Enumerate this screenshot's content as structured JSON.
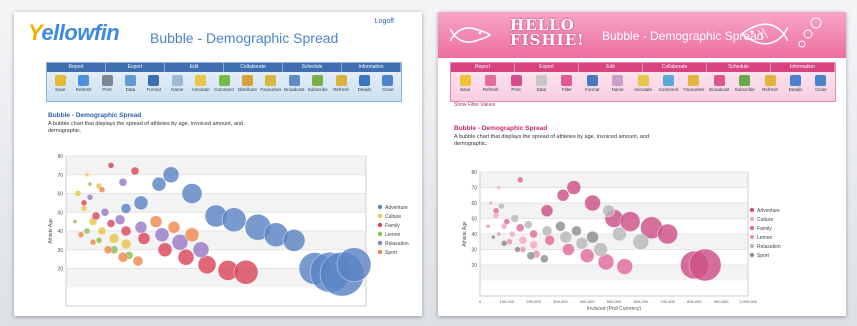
{
  "left": {
    "logo": {
      "first": "Y",
      "rest": "ellowfin"
    },
    "title": "Bubble - Demographic Spread",
    "logoff": "Logoff",
    "toolbar_groups": [
      "Report",
      "Export",
      "Edit",
      "Collaborate",
      "Schedule",
      "Information"
    ],
    "toolbar_buttons": [
      {
        "label": "Save",
        "icon": "save-icon",
        "color": "#e6b93a"
      },
      {
        "label": "Refresh",
        "icon": "refresh-icon",
        "color": "#4c92d8"
      },
      {
        "label": "Print",
        "icon": "print-icon",
        "color": "#7a8794"
      },
      {
        "label": "Data",
        "icon": "data-icon",
        "color": "#5f9ad6"
      },
      {
        "label": "Format",
        "icon": "format-icon",
        "color": "#3d6fae"
      },
      {
        "label": "Name",
        "icon": "name-icon",
        "color": "#9fb8d4"
      },
      {
        "label": "Annotate",
        "icon": "annotate-icon",
        "color": "#e9c648"
      },
      {
        "label": "Comment",
        "icon": "comment-icon",
        "color": "#78b848"
      },
      {
        "label": "Distribute",
        "icon": "distribute-icon",
        "color": "#d7a23a"
      },
      {
        "label": "Favourites",
        "icon": "favourites-icon",
        "color": "#d9b63f"
      },
      {
        "label": "Broadcast",
        "icon": "broadcast-icon",
        "color": "#6189c2"
      },
      {
        "label": "Subscribe",
        "icon": "subscribe-icon",
        "color": "#79b04a"
      },
      {
        "label": "Refresh",
        "icon": "schedule-refresh-icon",
        "color": "#d8b23a"
      },
      {
        "label": "Details",
        "icon": "info-icon",
        "color": "#3d74c4"
      },
      {
        "label": "Close",
        "icon": "close-icon",
        "color": "#4c83cc"
      }
    ],
    "section_title": "Bubble - Demographic Spread",
    "section_desc": "A bubble chart that displays the spread of athletes by age, invoiced amount, and demographic.",
    "colors": {
      "title": "#2c5fa8"
    }
  },
  "right": {
    "hello": [
      "HELLO",
      "FISHIE!"
    ],
    "title": "Bubble - Demographic Spread",
    "toolbar_groups": [
      "Report",
      "Export",
      "Edit",
      "Collaborate",
      "Schedule",
      "Information"
    ],
    "toolbar_buttons": [
      {
        "label": "Save",
        "icon": "save-icon",
        "color": "#f0c23a"
      },
      {
        "label": "Refresh",
        "icon": "refresh-icon",
        "color": "#e36d9f"
      },
      {
        "label": "Print",
        "icon": "print-icon",
        "color": "#d34d8a"
      },
      {
        "label": "Data",
        "icon": "data-icon",
        "color": "#c7c7c7"
      },
      {
        "label": "Filter",
        "icon": "filter-icon",
        "color": "#e05b96"
      },
      {
        "label": "Format",
        "icon": "format-icon",
        "color": "#4a78bf"
      },
      {
        "label": "Name",
        "icon": "name-icon",
        "color": "#c8a0c8"
      },
      {
        "label": "Annotate",
        "icon": "annotate-icon",
        "color": "#e7c545"
      },
      {
        "label": "Comment",
        "icon": "comment-icon",
        "color": "#58a8d8"
      },
      {
        "label": "Favourites",
        "icon": "favourites-icon",
        "color": "#e3b63f"
      },
      {
        "label": "Broadcast",
        "icon": "broadcast-icon",
        "color": "#d9568f"
      },
      {
        "label": "Subscribe",
        "icon": "subscribe-icon",
        "color": "#6aa84a"
      },
      {
        "label": "Refresh",
        "icon": "schedule-refresh-icon",
        "color": "#e0b43a"
      },
      {
        "label": "Details",
        "icon": "info-icon",
        "color": "#4a7fd0"
      },
      {
        "label": "Close",
        "icon": "close-icon",
        "color": "#4a83cc"
      }
    ],
    "sub_link": "Show Filter Values",
    "section_title": "Bubble - Demographic Spread",
    "section_desc": "A bubble chart that displays the spread of athletes by age, invoiced amount, and demographic.",
    "colors": {
      "title": "#c7286a"
    }
  },
  "chart_data": [
    {
      "type": "scatter",
      "title": "",
      "xlabel": "",
      "ylabel": "Athlete Age",
      "xlim": [
        0,
        1000000
      ],
      "ylim": [
        0,
        80
      ],
      "yticks": [
        20,
        30,
        40,
        50,
        60,
        70,
        80
      ],
      "grid": true,
      "legend_position": "right",
      "series": [
        {
          "name": "Adventure",
          "color": "#5b84c4",
          "points": [
            [
              310000,
              65,
              7
            ],
            [
              350000,
              70,
              8
            ],
            [
              420000,
              60,
              10
            ],
            [
              500000,
              48,
              11
            ],
            [
              560000,
              46,
              12
            ],
            [
              640000,
              42,
              13
            ],
            [
              700000,
              38,
              12
            ],
            [
              760000,
              35,
              11
            ],
            [
              830000,
              20,
              16
            ],
            [
              880000,
              18,
              20
            ],
            [
              920000,
              17,
              22
            ],
            [
              960000,
              22,
              17
            ],
            [
              250000,
              55,
              7
            ],
            [
              200000,
              52,
              5
            ]
          ]
        },
        {
          "name": "Culture",
          "color": "#e8c64a",
          "points": [
            [
              40000,
              60,
              3
            ],
            [
              60000,
              52,
              3
            ],
            [
              90000,
              45,
              4
            ],
            [
              120000,
              40,
              4
            ],
            [
              160000,
              36,
              5
            ],
            [
              200000,
              33,
              5
            ],
            [
              70000,
              70,
              2
            ],
            [
              110000,
              64,
              3
            ]
          ]
        },
        {
          "name": "Family",
          "color": "#d9475c",
          "points": [
            [
              60000,
              55,
              3
            ],
            [
              100000,
              48,
              4
            ],
            [
              150000,
              44,
              4
            ],
            [
              200000,
              40,
              5
            ],
            [
              260000,
              36,
              6
            ],
            [
              330000,
              30,
              7
            ],
            [
              400000,
              26,
              8
            ],
            [
              470000,
              22,
              9
            ],
            [
              540000,
              19,
              10
            ],
            [
              600000,
              18,
              12
            ],
            [
              150000,
              75,
              3
            ],
            [
              230000,
              72,
              4
            ]
          ]
        },
        {
          "name": "Lemon",
          "color": "#8fbc4a",
          "points": [
            [
              30000,
              45,
              2
            ],
            [
              70000,
              40,
              3
            ],
            [
              110000,
              35,
              3
            ],
            [
              160000,
              30,
              4
            ],
            [
              210000,
              27,
              4
            ],
            [
              80000,
              65,
              2
            ]
          ]
        },
        {
          "name": "Relaxation",
          "color": "#9b7ac8",
          "points": [
            [
              80000,
              58,
              3
            ],
            [
              130000,
              50,
              4
            ],
            [
              180000,
              46,
              5
            ],
            [
              250000,
              42,
              6
            ],
            [
              320000,
              38,
              7
            ],
            [
              380000,
              34,
              8
            ],
            [
              450000,
              30,
              8
            ],
            [
              190000,
              66,
              4
            ]
          ]
        },
        {
          "name": "Sport",
          "color": "#ee8a52",
          "points": [
            [
              50000,
              38,
              3
            ],
            [
              90000,
              34,
              3
            ],
            [
              140000,
              30,
              4
            ],
            [
              190000,
              26,
              5
            ],
            [
              240000,
              24,
              5
            ],
            [
              300000,
              45,
              6
            ],
            [
              360000,
              42,
              6
            ],
            [
              420000,
              38,
              7
            ],
            [
              120000,
              62,
              3
            ]
          ]
        }
      ]
    },
    {
      "type": "scatter",
      "title": "",
      "xlabel": "Invoiced (Prof Currency)",
      "ylabel": "Athlete Age",
      "xlim": [
        0,
        1000000
      ],
      "ylim": [
        0,
        80
      ],
      "xticks": [
        "0",
        "100,000",
        "200,000",
        "300,000",
        "400,000",
        "500,000",
        "600,000",
        "700,000",
        "800,000",
        "900,000",
        "1,000,000"
      ],
      "yticks": [
        20,
        30,
        40,
        50,
        60,
        70,
        80
      ],
      "grid": true,
      "legend_position": "right",
      "series": [
        {
          "name": "Adventure",
          "color": "#cc4f86",
          "points": [
            [
              310000,
              65,
              6
            ],
            [
              350000,
              70,
              7
            ],
            [
              420000,
              60,
              8
            ],
            [
              500000,
              50,
              9
            ],
            [
              560000,
              48,
              10
            ],
            [
              640000,
              44,
              11
            ],
            [
              700000,
              40,
              10
            ],
            [
              800000,
              20,
              14
            ],
            [
              840000,
              20,
              16
            ],
            [
              250000,
              55,
              6
            ]
          ]
        },
        {
          "name": "Culture",
          "color": "#f2a7c8",
          "points": [
            [
              40000,
              60,
              2
            ],
            [
              60000,
              52,
              3
            ],
            [
              90000,
              45,
              3
            ],
            [
              120000,
              40,
              3
            ],
            [
              160000,
              36,
              4
            ],
            [
              200000,
              33,
              4
            ],
            [
              70000,
              70,
              2
            ]
          ]
        },
        {
          "name": "Family",
          "color": "#e06a9c",
          "points": [
            [
              60000,
              55,
              3
            ],
            [
              100000,
              48,
              3
            ],
            [
              150000,
              44,
              4
            ],
            [
              200000,
              40,
              4
            ],
            [
              260000,
              36,
              5
            ],
            [
              330000,
              30,
              6
            ],
            [
              400000,
              26,
              7
            ],
            [
              470000,
              22,
              8
            ],
            [
              540000,
              19,
              8
            ],
            [
              150000,
              75,
              3
            ]
          ]
        },
        {
          "name": "Lemon",
          "color": "#e890b8",
          "points": [
            [
              30000,
              45,
              2
            ],
            [
              70000,
              40,
              2
            ],
            [
              110000,
              35,
              3
            ],
            [
              160000,
              30,
              3
            ],
            [
              210000,
              27,
              4
            ]
          ]
        },
        {
          "name": "Relaxation",
          "color": "#b8b8b8",
          "points": [
            [
              80000,
              58,
              3
            ],
            [
              130000,
              50,
              4
            ],
            [
              180000,
              46,
              4
            ],
            [
              250000,
              42,
              5
            ],
            [
              320000,
              38,
              6
            ],
            [
              380000,
              34,
              6
            ],
            [
              450000,
              30,
              7
            ],
            [
              520000,
              40,
              7
            ],
            [
              600000,
              35,
              8
            ],
            [
              480000,
              55,
              6
            ]
          ]
        },
        {
          "name": "Sport",
          "color": "#8e8e8e",
          "points": [
            [
              50000,
              38,
              2
            ],
            [
              90000,
              34,
              3
            ],
            [
              140000,
              30,
              3
            ],
            [
              190000,
              26,
              4
            ],
            [
              240000,
              24,
              4
            ],
            [
              300000,
              45,
              5
            ],
            [
              360000,
              42,
              5
            ],
            [
              420000,
              38,
              6
            ]
          ]
        }
      ]
    }
  ]
}
